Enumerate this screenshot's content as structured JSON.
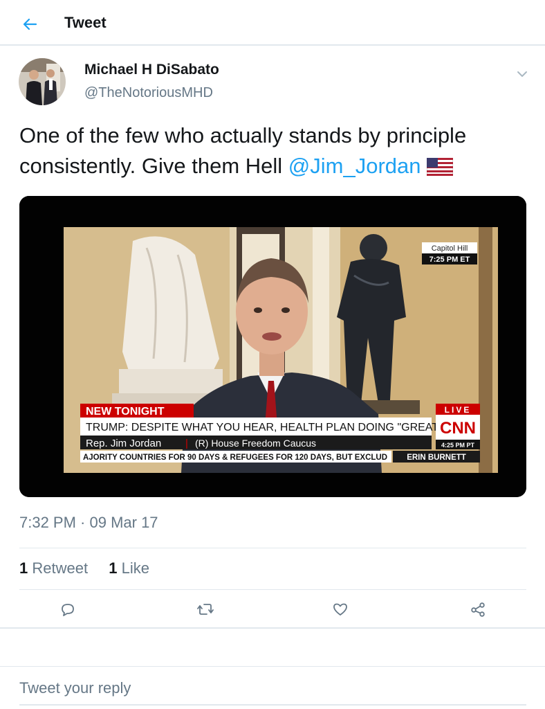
{
  "header": {
    "title": "Tweet"
  },
  "author": {
    "name": "Michael H DiSabato",
    "handle": "@TheNotoriousMHD"
  },
  "tweet": {
    "text_part1": "One of the few who actually stands by principle consistently. Give them Hell ",
    "mention": "@Jim_Jordan",
    "emoji": "🇺🇸",
    "timestamp": "7:32 PM · 09 Mar 17"
  },
  "media": {
    "location": "Capitol Hill",
    "time_et": "7:25 PM ET",
    "banner_label": "NEW TONIGHT",
    "headline": "TRUMP: DESPITE WHAT YOU HEAR, HEALTH PLAN DOING \"GREAT\"",
    "name_tag": "Rep. Jim Jordan",
    "name_sep": "|",
    "affiliation": "(R) House Freedom Caucus",
    "live": "LIVE",
    "network": "CNN",
    "time_pt": "4:25 PM PT",
    "ticker": "AJORITY COUNTRIES FOR 90 DAYS & REFUGEES FOR 120 DAYS, BUT EXCLUD",
    "show": "ERIN BURNETT"
  },
  "stats": {
    "retweet_count": "1",
    "retweet_label": "Retweet",
    "like_count": "1",
    "like_label": "Like"
  },
  "reply": {
    "placeholder": "Tweet your reply"
  },
  "colors": {
    "accent": "#1da1f2",
    "muted": "#657786",
    "text": "#14171a",
    "cnn_red": "#cc0000"
  },
  "icons": [
    "back-arrow-icon",
    "chevron-down-icon",
    "us-flag-icon",
    "reply-icon",
    "retweet-icon",
    "like-heart-icon",
    "share-icon"
  ]
}
